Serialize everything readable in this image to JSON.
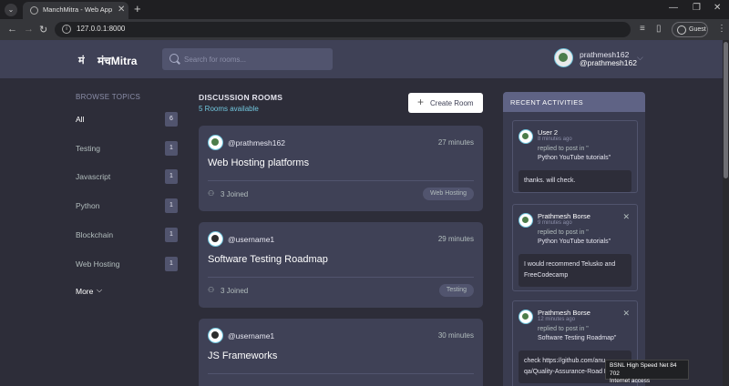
{
  "browser": {
    "tab_title": "ManchMitra - Web App for Co",
    "tab_close": "✕",
    "new_tab": "+",
    "url": "127.0.0.1:8000",
    "guest_label": "Guest"
  },
  "header": {
    "logo_icon": "मं",
    "logo_text": "मंचMitra",
    "search_placeholder": "Search for rooms...",
    "user_name": "prathmesh162",
    "user_handle": "@prathmesh162"
  },
  "topics": {
    "heading": "BROWSE TOPICS",
    "items": [
      {
        "label": "All",
        "count": "6"
      },
      {
        "label": "Testing",
        "count": "1"
      },
      {
        "label": "Javascript",
        "count": "1"
      },
      {
        "label": "Python",
        "count": "1"
      },
      {
        "label": "Blockchain",
        "count": "1"
      },
      {
        "label": "Web Hosting",
        "count": "1"
      }
    ],
    "more_label": "More"
  },
  "rooms": {
    "title": "DISCUSSION ROOMS",
    "subtitle": "5 Rooms available",
    "create_label": "Create Room",
    "items": [
      {
        "host": "@prathmesh162",
        "time": "27 minutes",
        "name": "Web Hosting platforms",
        "joined": "3 Joined",
        "tag": "Web Hosting"
      },
      {
        "host": "@username1",
        "time": "29 minutes",
        "name": "Software Testing Roadmap",
        "joined": "3 Joined",
        "tag": "Testing"
      },
      {
        "host": "@username1",
        "time": "30 minutes",
        "name": "JS Frameworks",
        "joined": "",
        "tag": ""
      }
    ]
  },
  "activities": {
    "title": "RECENT ACTIVITIES",
    "items": [
      {
        "user": "User 2",
        "time": "8 minutes ago",
        "text": "replied to post in \"",
        "room": "Python YouTube tutorials\"",
        "message": "thanks. will check."
      },
      {
        "user": "Prathmesh Borse",
        "time": "9 minutes ago",
        "text": "replied to post in \"",
        "room": "Python YouTube tutorials\"",
        "message": "I would recommend Telusko and FreeCodecamp"
      },
      {
        "user": "Prathmesh Borse",
        "time": "12 minutes ago",
        "text": "replied to post in \"",
        "room": "Software Testing Roadmap\"",
        "message": "check https://github.com/anu qa/Quality-Assurance-Road Map"
      }
    ]
  },
  "tooltip": {
    "line1": "BSNL High Speed Net 84 702",
    "line2": "Internet access"
  }
}
